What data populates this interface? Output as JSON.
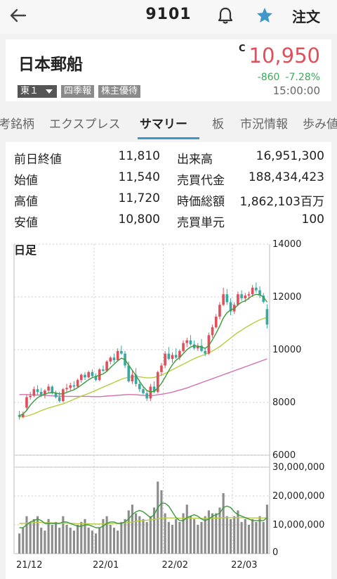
{
  "header": {
    "code": "9101",
    "order_label": "注文",
    "back_icon": "arrow-left-icon",
    "bell_icon": "bell-icon",
    "star_icon": "star-icon",
    "star_color": "#3f98c9"
  },
  "stock": {
    "name": "日本郵船",
    "market": "東１",
    "tags": [
      "四季報",
      "株主優待"
    ],
    "c_flag": "C",
    "price": "10,950",
    "change": "-860",
    "change_pct": "-7.28%",
    "time": "15:00:00",
    "price_color": "#e0505c",
    "change_color": "#3aaa5a"
  },
  "tabs": [
    "考銘柄",
    "エクスプレス",
    "サマリー",
    "板",
    "市況情報",
    "歩み値"
  ],
  "active_tab": "サマリー",
  "stats": [
    {
      "label": "前日終値",
      "value": "11,810"
    },
    {
      "label": "出来高",
      "value": "16,951,300"
    },
    {
      "label": "始値",
      "value": "11,540"
    },
    {
      "label": "売買代金",
      "value": "188,434,423"
    },
    {
      "label": "高値",
      "value": "11,720"
    },
    {
      "label": "時価総額",
      "value": "1,862,103百万"
    },
    {
      "label": "安値",
      "value": "10,800"
    },
    {
      "label": "売買単元",
      "value": "100"
    }
  ],
  "chart_label": "日足",
  "chart_data": {
    "type": "candlestick",
    "x_labels": [
      "21/12",
      "22/01",
      "22/02",
      "22/03"
    ],
    "price_axis": {
      "ticks": [
        "14000",
        "12000",
        "10000",
        "8000",
        "6000"
      ],
      "ylim": [
        6000,
        14000
      ]
    },
    "volume_axis": {
      "ticks": [
        "30,000,000",
        "20,000,000",
        "10,000,000",
        "0"
      ],
      "ylim": [
        0,
        30000000
      ]
    },
    "up_color": "#e0505c",
    "down_color": "#3aa8a0",
    "ma_short_color": "#3a9a3a",
    "ma_mid_color": "#b8cc40",
    "ma_long_color": "#d070b0",
    "candles": [
      [
        7520,
        7680,
        7350,
        7450
      ],
      [
        7450,
        7650,
        7400,
        7550
      ],
      [
        7800,
        8300,
        7700,
        8200
      ],
      [
        8200,
        8400,
        8100,
        8250
      ],
      [
        8250,
        8600,
        8200,
        8500
      ],
      [
        8500,
        8650,
        8300,
        8400
      ],
      [
        8400,
        8550,
        8200,
        8300
      ],
      [
        8300,
        8500,
        8150,
        8450
      ],
      [
        8450,
        8700,
        8350,
        8600
      ],
      [
        8600,
        8650,
        8300,
        8350
      ],
      [
        8350,
        8450,
        8150,
        8200
      ],
      [
        8200,
        8400,
        8000,
        8050
      ],
      [
        8050,
        8550,
        8000,
        8500
      ],
      [
        8500,
        8700,
        8400,
        8550
      ],
      [
        8550,
        8750,
        8450,
        8650
      ],
      [
        8650,
        8800,
        8500,
        8600
      ],
      [
        8600,
        8900,
        8550,
        8850
      ],
      [
        8850,
        9100,
        8750,
        9050
      ],
      [
        9050,
        9150,
        8850,
        8950
      ],
      [
        8950,
        9200,
        8900,
        9150
      ],
      [
        9150,
        9250,
        8950,
        9000
      ],
      [
        9000,
        9100,
        8800,
        8850
      ],
      [
        8850,
        9300,
        8800,
        9250
      ],
      [
        9250,
        9400,
        9150,
        9200
      ],
      [
        9200,
        9600,
        9150,
        9550
      ],
      [
        9550,
        9750,
        9450,
        9700
      ],
      [
        9700,
        9850,
        9500,
        9600
      ],
      [
        9600,
        10050,
        9550,
        9950
      ],
      [
        9950,
        10150,
        9800,
        9850
      ],
      [
        9850,
        9950,
        9300,
        9400
      ],
      [
        9400,
        9550,
        8750,
        8800
      ],
      [
        8800,
        9200,
        8700,
        9050
      ],
      [
        9050,
        9300,
        8600,
        8700
      ],
      [
        8700,
        8850,
        8400,
        8500
      ],
      [
        8500,
        8600,
        8300,
        8350
      ],
      [
        8350,
        8450,
        8050,
        8150
      ],
      [
        8150,
        8700,
        8050,
        8600
      ],
      [
        8600,
        8800,
        8350,
        8400
      ],
      [
        8400,
        9200,
        8350,
        9150
      ],
      [
        9150,
        9500,
        9000,
        9400
      ],
      [
        9400,
        9950,
        9300,
        9850
      ],
      [
        9850,
        10100,
        9600,
        9650
      ],
      [
        9650,
        9900,
        9500,
        9800
      ],
      [
        9800,
        10050,
        9650,
        9700
      ],
      [
        9700,
        10000,
        9600,
        9950
      ],
      [
        9950,
        10350,
        9900,
        10250
      ],
      [
        10250,
        10450,
        10100,
        10350
      ],
      [
        10350,
        10550,
        10150,
        10200
      ],
      [
        10200,
        10350,
        10000,
        10050
      ],
      [
        10050,
        10250,
        9950,
        10150
      ],
      [
        10150,
        10400,
        9900,
        9950
      ],
      [
        9950,
        10050,
        9750,
        9850
      ],
      [
        9850,
        10650,
        9800,
        10550
      ],
      [
        10550,
        10950,
        10450,
        10850
      ],
      [
        10850,
        11350,
        10800,
        11250
      ],
      [
        11250,
        11800,
        11150,
        11700
      ],
      [
        11700,
        12350,
        11650,
        12100
      ],
      [
        12100,
        12300,
        11700,
        11800
      ],
      [
        11800,
        11950,
        11300,
        11450
      ],
      [
        11450,
        11800,
        11350,
        11700
      ],
      [
        11700,
        12200,
        11650,
        12100
      ],
      [
        12100,
        12250,
        11850,
        11950
      ],
      [
        11950,
        12150,
        11800,
        12050
      ],
      [
        12050,
        12200,
        11900,
        12100
      ],
      [
        12100,
        12450,
        12000,
        12350
      ],
      [
        12350,
        12550,
        12150,
        12250
      ],
      [
        12250,
        12400,
        11950,
        12050
      ],
      [
        12050,
        12150,
        11750,
        11810
      ],
      [
        11540,
        11720,
        10800,
        10950
      ]
    ],
    "ma_short": [
      7500,
      7560,
      7700,
      7900,
      8050,
      8180,
      8260,
      8310,
      8360,
      8380,
      8360,
      8320,
      8330,
      8380,
      8430,
      8480,
      8560,
      8660,
      8760,
      8860,
      8940,
      8990,
      9030,
      9080,
      9180,
      9320,
      9450,
      9580,
      9680,
      9620,
      9420,
      9220,
      9020,
      8800,
      8600,
      8450,
      8400,
      8420,
      8550,
      8720,
      8950,
      9200,
      9430,
      9600,
      9700,
      9850,
      10000,
      10100,
      10150,
      10130,
      10100,
      10050,
      10150,
      10380,
      10620,
      10900,
      11200,
      11400,
      11500,
      11550,
      11700,
      11800,
      11850,
      11950,
      12050,
      12100,
      12080,
      12000,
      11800
    ],
    "ma_mid": [
      7450,
      7460,
      7480,
      7520,
      7570,
      7630,
      7690,
      7740,
      7790,
      7830,
      7870,
      7910,
      7950,
      8000,
      8060,
      8120,
      8180,
      8240,
      8290,
      8340,
      8400,
      8460,
      8520,
      8580,
      8640,
      8700,
      8760,
      8820,
      8880,
      8920,
      8950,
      8970,
      8980,
      8970,
      8950,
      8930,
      8930,
      8950,
      8990,
      9040,
      9100,
      9170,
      9240,
      9310,
      9380,
      9450,
      9520,
      9590,
      9660,
      9720,
      9770,
      9820,
      9880,
      9950,
      10030,
      10120,
      10220,
      10330,
      10440,
      10550,
      10650,
      10740,
      10830,
      10910,
      10990,
      11060,
      11130,
      11180,
      11220
    ],
    "ma_long": [
      8300,
      8300,
      8300,
      8290,
      8280,
      8280,
      8280,
      8270,
      8260,
      8250,
      8240,
      8240,
      8230,
      8230,
      8230,
      8230,
      8230,
      8230,
      8230,
      8230,
      8220,
      8220,
      8220,
      8230,
      8240,
      8250,
      8260,
      8270,
      8280,
      8290,
      8300,
      8300,
      8290,
      8280,
      8270,
      8260,
      8260,
      8270,
      8290,
      8310,
      8330,
      8360,
      8390,
      8430,
      8470,
      8510,
      8550,
      8600,
      8650,
      8700,
      8750,
      8800,
      8850,
      8900,
      8950,
      9000,
      9050,
      9100,
      9150,
      9200,
      9250,
      9300,
      9350,
      9400,
      9450,
      9500,
      9550,
      9600,
      9650
    ],
    "volume": [
      7000000,
      9000000,
      13000000,
      11000000,
      12000000,
      13000000,
      9000000,
      8000000,
      12000000,
      10000000,
      11000000,
      9000000,
      13000000,
      10000000,
      9000000,
      8000000,
      10000000,
      11000000,
      12000000,
      9000000,
      8000000,
      7000000,
      9000000,
      12000000,
      13000000,
      10000000,
      9000000,
      8000000,
      11000000,
      12000000,
      15000000,
      17000000,
      14000000,
      13000000,
      12000000,
      11000000,
      13000000,
      16000000,
      25000000,
      22000000,
      14000000,
      11000000,
      10000000,
      12000000,
      11000000,
      14000000,
      17000000,
      13000000,
      12000000,
      10000000,
      11000000,
      13000000,
      15000000,
      14000000,
      14000000,
      16000000,
      21000000,
      13000000,
      12000000,
      13000000,
      15000000,
      11000000,
      12000000,
      10000000,
      12000000,
      11000000,
      13000000,
      11000000,
      17000000
    ],
    "volume_ma_short": [
      9000000,
      9000000,
      10000000,
      11000000,
      11500000,
      12000000,
      11500000,
      10500000,
      10500000,
      10500000,
      10500000,
      10500000,
      11000000,
      11000000,
      10500000,
      10000000,
      9500000,
      9500000,
      10000000,
      10000000,
      9500000,
      9000000,
      9000000,
      9500000,
      10500000,
      11000000,
      11000000,
      10500000,
      10500000,
      11000000,
      12000000,
      13500000,
      14500000,
      15000000,
      14500000,
      13500000,
      12500000,
      13500000,
      16000000,
      17500000,
      17500000,
      16500000,
      14500000,
      12500000,
      11500000,
      11500000,
      12500000,
      13000000,
      13500000,
      13000000,
      12000000,
      11500000,
      12000000,
      13000000,
      13500000,
      14000000,
      16000000,
      16500000,
      16000000,
      14500000,
      13500000,
      13000000,
      12500000,
      12000000,
      11500000,
      11500000,
      11500000,
      11500000,
      12500000
    ],
    "volume_ma_long": [
      10500000,
      10500000,
      10600000,
      10700000,
      10800000,
      10800000,
      10800000,
      10700000,
      10700000,
      10700000,
      10600000,
      10600000,
      10600000,
      10600000,
      10500000,
      10500000,
      10400000,
      10400000,
      10400000,
      10400000,
      10300000,
      10300000,
      10300000,
      10300000,
      10400000,
      10500000,
      10500000,
      10500000,
      10600000,
      10700000,
      10800000,
      11000000,
      11200000,
      11400000,
      11500000,
      11600000,
      11700000,
      11900000,
      12100000,
      12300000,
      12400000,
      12400000,
      12400000,
      12400000,
      12300000,
      12300000,
      12300000,
      12300000,
      12300000,
      12300000,
      12200000,
      12200000,
      12200000,
      12300000,
      12300000,
      12400000,
      12500000,
      12500000,
      12500000,
      12500000,
      12500000,
      12500000,
      12500000,
      12400000,
      12400000,
      12400000,
      12400000,
      12400000,
      12500000
    ]
  }
}
